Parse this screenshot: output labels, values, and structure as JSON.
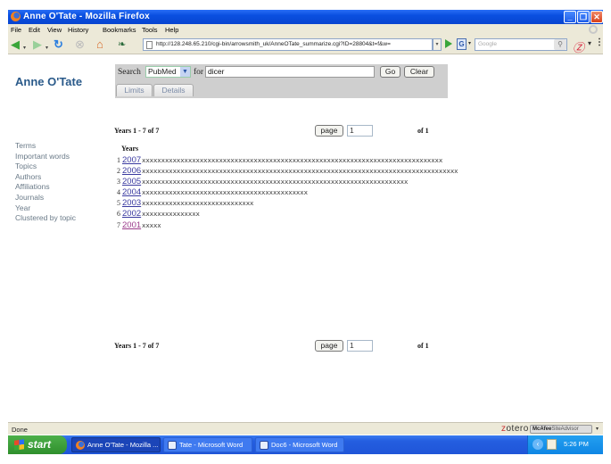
{
  "window": {
    "title": "Anne O'Tate - Mozilla Firefox",
    "controls": {
      "minimize": "_",
      "restore": "❐",
      "close": "✕"
    }
  },
  "menubar": {
    "items": [
      "File",
      "Edit",
      "View",
      "History",
      "Bookmarks",
      "Tools",
      "Help"
    ]
  },
  "navbar": {
    "url": "http://128.248.65.210/cgi-bin/arrowsmith_uk/AnneOTate_summarize.cgi?ID=28804&t=f&w=",
    "search_engine_placeholder": "Google",
    "icons": [
      "back-icon",
      "forward-icon",
      "reload-icon",
      "stop-icon",
      "home-icon",
      "bookmark-leaf-icon",
      "go-icon",
      "search-engine-icon",
      "zotero-icon"
    ]
  },
  "page": {
    "brand": "Anne O'Tate",
    "search": {
      "label": "Search",
      "database": "PubMed",
      "for_label": "for",
      "query": "dicer",
      "go_label": "Go",
      "clear_label": "Clear"
    },
    "tabs": [
      "Limits",
      "Details"
    ],
    "sidebar": [
      "Terms",
      "Important words",
      "Topics",
      "Authors",
      "Affiliations",
      "Journals",
      "Year",
      "Clustered by topic"
    ],
    "pagination_top": {
      "summary": "Years 1 - 7 of 7",
      "page_button": "page",
      "page_value": "1",
      "of_label": "of 1"
    },
    "pagination_bottom": {
      "summary": "Years 1 - 7 of 7",
      "page_button": "page",
      "page_value": "1",
      "of_label": "of 1"
    },
    "years_header": "Years",
    "years": [
      {
        "index": "1",
        "year": "2007",
        "bar_length": 78,
        "visited": false
      },
      {
        "index": "2",
        "year": "2006",
        "bar_length": 82,
        "visited": false
      },
      {
        "index": "3",
        "year": "2005",
        "bar_length": 69,
        "visited": false
      },
      {
        "index": "4",
        "year": "2004",
        "bar_length": 43,
        "visited": false
      },
      {
        "index": "5",
        "year": "2003",
        "bar_length": 29,
        "visited": false
      },
      {
        "index": "6",
        "year": "2002",
        "bar_length": 15,
        "visited": false
      },
      {
        "index": "7",
        "year": "2001",
        "bar_length": 5,
        "visited": true
      }
    ],
    "bar_char": "x"
  },
  "statusbar": {
    "status": "Done",
    "zotero_label": "zotero",
    "mcafee_brand": "McAfee",
    "mcafee_label": "SiteAdvisor"
  },
  "taskbar": {
    "start_label": "start",
    "tasks": [
      {
        "label": "Anne O'Tate - Mozilla ...",
        "active": true,
        "icon": "firefox-icon"
      },
      {
        "label": "Tate - Microsoft Word",
        "active": false,
        "icon": "word-icon"
      },
      {
        "label": "Doc6 - Microsoft Word",
        "active": false,
        "icon": "word-icon"
      }
    ],
    "clock": "5:26 PM"
  }
}
